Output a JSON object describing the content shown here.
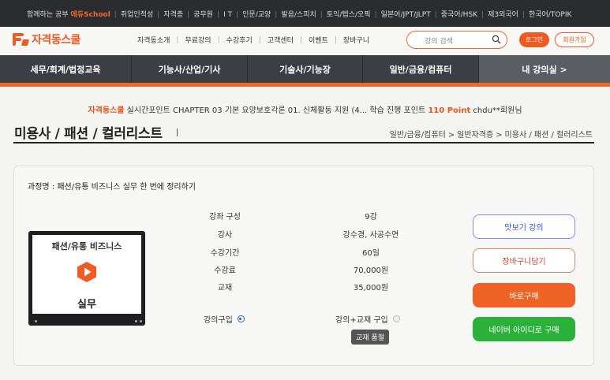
{
  "topbar": {
    "tagline": "함께하는 공부",
    "brand": "에듀School",
    "links": [
      "취업인적성",
      "자격증",
      "공무원",
      "I T",
      "인문/교양",
      "발음/스피치",
      "토익/텝스/오픽",
      "일본어/JPT/JLPT",
      "중국어/HSK",
      "제3외국어",
      "한국어/TOPIK"
    ]
  },
  "header": {
    "logo_text": "자격동스쿨",
    "menu": [
      "자격동소개",
      "무료강의",
      "수강후기",
      "고객센터",
      "이벤트",
      "장바구니"
    ],
    "search_placeholder": "강의 검색",
    "login": "로그인",
    "join": "회원가입"
  },
  "nav": {
    "items": [
      "세무/회계/법정교육",
      "기능사/산업/기사",
      "기술사/기능장",
      "일반/금융/컴퓨터"
    ],
    "my_course": "내 강의실 >"
  },
  "ticker": {
    "brand": "자격동스쿨",
    "text": " 실시간포인트 CHAPTER 03 기본 요양보호각론 01. 신체활동 지원 (4... 학습 진행 포인트 ",
    "points": "110 Point",
    "user": " chdu**회원님"
  },
  "page": {
    "title": "미용사 / 패션 / 컬러리스트",
    "breadcrumb": [
      "일반/금융/컴퓨터",
      "일반자격증",
      "미용사 / 패션 / 컬러리스트"
    ]
  },
  "course": {
    "name_label": "과정명 : ",
    "name": "패션/유통 비즈니스 실무 한 번에 정리하기",
    "thumb_title": "패션/유통 비즈니스",
    "thumb_sub": "실무",
    "info": [
      {
        "label": "강좌 구성",
        "value": "9강"
      },
      {
        "label": "강사",
        "value": "강수경, 사공수연"
      },
      {
        "label": "수강기간",
        "value": "60일"
      },
      {
        "label": "수강료",
        "value": "70,000원"
      },
      {
        "label": "교재",
        "value": "35,000원"
      }
    ],
    "option_lecture": "강의구입",
    "option_lecture_book": "강의+교재 구입",
    "option_selected": "lecture",
    "soldout": "교재 품절",
    "buttons": {
      "preview": "맛보기 강의",
      "cart": "장바구니담기",
      "buy_now": "바로구매",
      "naver": "네이버 아이디로 구매"
    }
  },
  "colors": {
    "accent": "#ee5a24",
    "nav_bg": "#3c3e45",
    "naver_green": "#2bb03a",
    "radio_blue": "#1f5fd1"
  }
}
